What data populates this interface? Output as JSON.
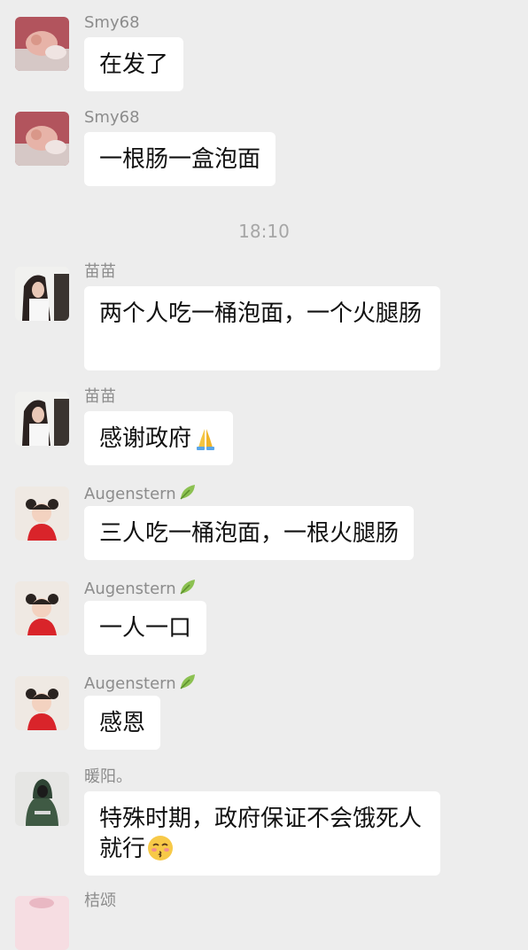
{
  "messages": [
    {
      "sender": "Smy68",
      "text": "在发了"
    },
    {
      "sender": "Smy68",
      "text": "一根肠一盒泡面"
    },
    {
      "sender": "苗苗",
      "text": "两个人吃一桶泡面，一个火腿肠"
    },
    {
      "sender": "苗苗",
      "text": "感谢政府"
    },
    {
      "sender": "Augenstern",
      "text": "三人吃一桶泡面，一根火腿肠"
    },
    {
      "sender": "Augenstern",
      "text": "一人一口"
    },
    {
      "sender": "Augenstern",
      "text": "感恩"
    },
    {
      "sender": "暖阳。",
      "text": "特殊时期，政府保证不会饿死人就行"
    },
    {
      "sender": "桔颂",
      "text": ""
    }
  ],
  "timestamp": "18:10",
  "icons": {
    "smy68_avatar": "hand-photo-avatar",
    "miaomiao_avatar": "girl-photo-avatar",
    "augenstern_avatar": "child-photo-avatar",
    "nuanyang_avatar": "hooded-figure-avatar",
    "leaf": "leaf-icon",
    "pray_emoji": "folded-hands-emoji",
    "kiss_emoji": "kissing-face-emoji"
  },
  "colors": {
    "background": "#ededed",
    "bubble": "#ffffff",
    "sender_text": "#8c8c8c",
    "timestamp_text": "#a6a6a6"
  }
}
